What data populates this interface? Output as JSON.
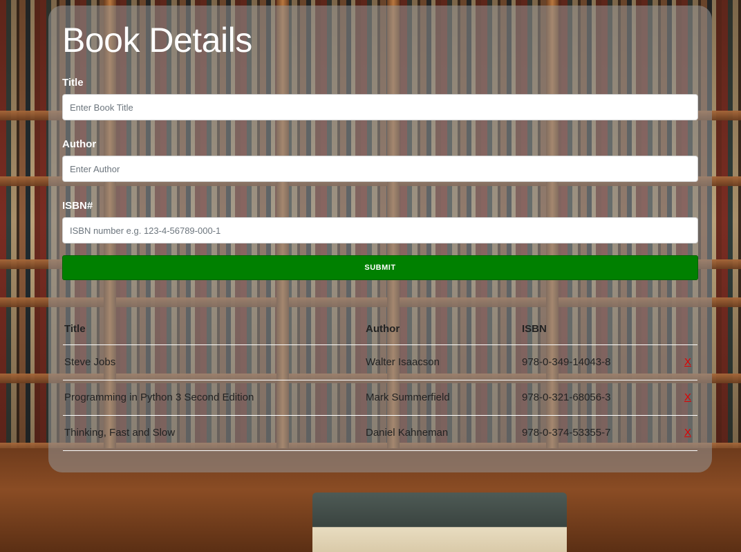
{
  "form": {
    "heading": "Book Details",
    "title_label": "Title",
    "title_placeholder": "Enter Book Title",
    "author_label": "Author",
    "author_placeholder": "Enter Author",
    "isbn_label": "ISBN#",
    "isbn_placeholder": "ISBN number e.g. 123-4-56789-000-1",
    "submit_label": "SUBMIT"
  },
  "table": {
    "headers": [
      "Title",
      "Author",
      "ISBN",
      ""
    ],
    "rows": [
      {
        "title": "Steve Jobs",
        "author": "Walter Isaacson",
        "isbn": "978-0-349-14043-8",
        "delete": "X"
      },
      {
        "title": "Programming in Python 3 Second Edition",
        "author": "Mark Summerfield",
        "isbn": "978-0-321-68056-3",
        "delete": "X"
      },
      {
        "title": "Thinking, Fast and Slow",
        "author": "Daniel Kahneman",
        "isbn": "978-0-374-53355-7",
        "delete": "X"
      }
    ]
  },
  "colors": {
    "submit": "#008000",
    "delete": "#e00000",
    "panel": "rgba(150,150,150,0.55)"
  }
}
